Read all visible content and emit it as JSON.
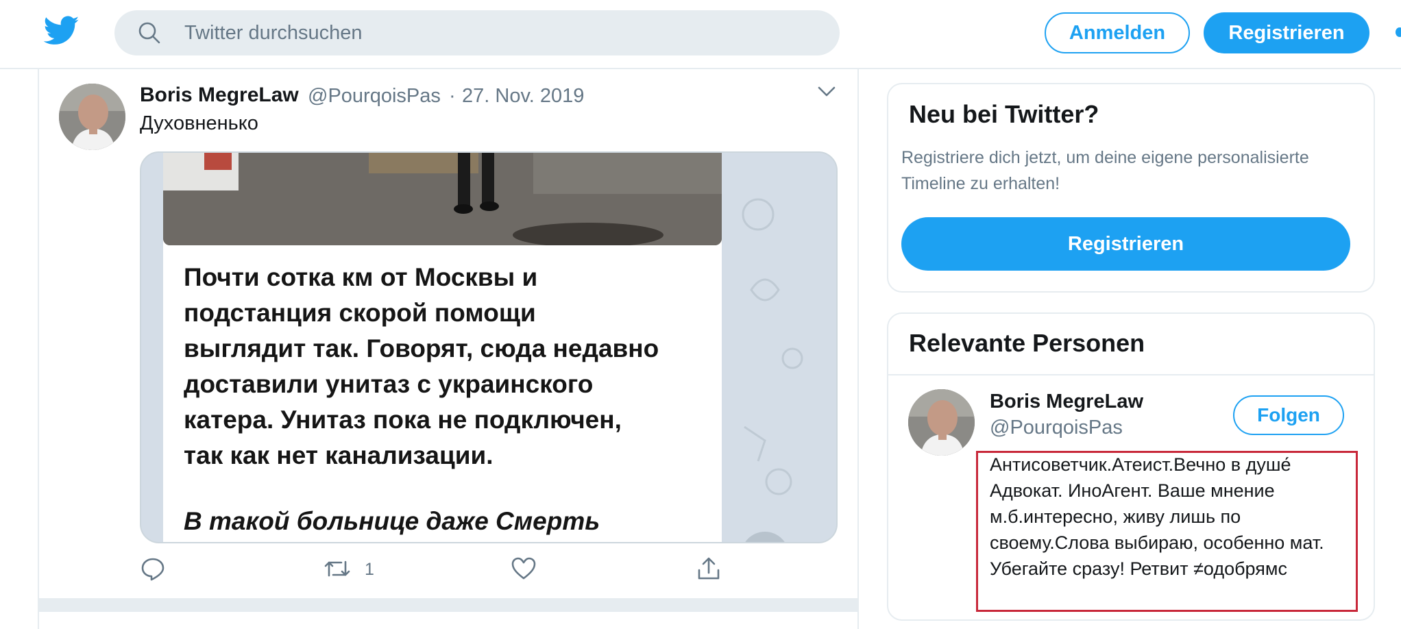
{
  "header": {
    "search_placeholder": "Twitter durchsuchen",
    "login_label": "Anmelden",
    "register_label": "Registrieren"
  },
  "tweet": {
    "author_name": "Boris MegreLaw",
    "author_handle": "@PourqoisPas",
    "separator": "·",
    "date": "27. Nov. 2019",
    "text": "Духовненько",
    "image_text_lines": [
      "Почти сотка км от Москвы и",
      "подстанция скорой помощи",
      "выглядит так. Говорят, сюда недавно",
      "доставили унитаз с украинского",
      "катера. Унитаз пока не подключен,",
      "так как нет канализации."
    ],
    "image_text_italic": "В такой больнице даже Смерть",
    "retweet_count": "1"
  },
  "sidebar": {
    "new_card": {
      "title": "Neu bei Twitter?",
      "description": "Registriere dich jetzt, um deine eigene personalisierte Timeline zu erhalten!",
      "register_label": "Registrieren"
    },
    "relevant_card": {
      "title": "Relevante Personen",
      "person": {
        "name": "Boris MegreLaw",
        "handle": "@PourqoisPas",
        "follow_label": "Folgen",
        "bio": "Антисоветчик.Атеист.Вечно в душе́ Адвокат. ИноАгент. Ваше мнение м.б.интересно, живу лишь по своему.Слова выбираю, особенно мат. Убегайте сразу! Ретвит ≠одобрямс"
      }
    }
  },
  "colors": {
    "accent": "#1da1f2",
    "secondary_text": "#657786",
    "highlight": "#c8283a"
  },
  "icons": [
    "twitter-bird-icon",
    "search-icon",
    "chevron-down-icon",
    "reply-icon",
    "retweet-icon",
    "like-icon",
    "share-icon"
  ]
}
